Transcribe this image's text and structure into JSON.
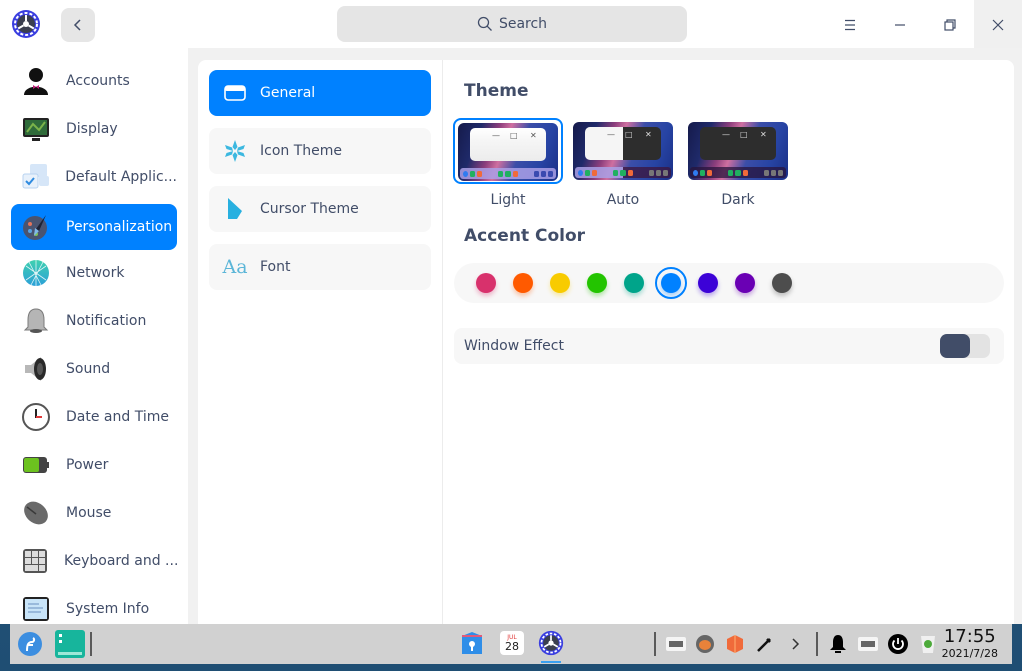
{
  "titlebar": {
    "search_placeholder": "Search",
    "back_icon": "chevron-left-icon",
    "menu_icon": "hamburger-menu-icon",
    "minimize_icon": "minimize-icon",
    "maximize_icon": "restore-icon",
    "close_icon": "close-icon"
  },
  "sidebar": {
    "items": [
      {
        "label": "Accounts",
        "icon": "accounts-icon"
      },
      {
        "label": "Display",
        "icon": "display-icon"
      },
      {
        "label": "Default Applic...",
        "icon": "default-applications-icon"
      },
      {
        "label": "Personalization",
        "icon": "personalization-icon",
        "active": true
      },
      {
        "label": "Network",
        "icon": "network-icon"
      },
      {
        "label": "Notification",
        "icon": "notification-icon"
      },
      {
        "label": "Sound",
        "icon": "sound-icon"
      },
      {
        "label": "Date and Time",
        "icon": "date-time-icon"
      },
      {
        "label": "Power",
        "icon": "power-icon"
      },
      {
        "label": "Mouse",
        "icon": "mouse-icon"
      },
      {
        "label": "Keyboard and ...",
        "icon": "keyboard-icon"
      },
      {
        "label": "System Info",
        "icon": "system-info-icon"
      }
    ]
  },
  "subnav": {
    "items": [
      {
        "label": "General",
        "icon": "general-window-icon",
        "active": true
      },
      {
        "label": "Icon Theme",
        "icon": "icon-theme-icon"
      },
      {
        "label": "Cursor Theme",
        "icon": "cursor-theme-icon"
      },
      {
        "label": "Font",
        "icon": "font-icon",
        "glyph": "Aa"
      }
    ]
  },
  "general": {
    "theme_title": "Theme",
    "themes": [
      {
        "label": "Light",
        "selected": true
      },
      {
        "label": "Auto"
      },
      {
        "label": "Dark"
      }
    ],
    "accent_title": "Accent Color",
    "accent_colors": [
      "#d8316c",
      "#ff5a00",
      "#f8cb00",
      "#23c400",
      "#00a48a",
      "#0081ff",
      "#3c02d7",
      "#6a00b4",
      "#4d4d4d"
    ],
    "accent_selected": "#0081ff",
    "window_effect_label": "Window Effect",
    "window_effect_enabled": false
  },
  "taskbar": {
    "left_icons": [
      "fedora-launcher-icon",
      "multitask-view-icon"
    ],
    "center_icons": [
      "file-manager-icon",
      "calendar-icon",
      "control-center-icon"
    ],
    "calendar_month": "JUL",
    "calendar_day": "28",
    "tray_icons": [
      "keyboard-layout-icon",
      "hamster-icon",
      "package-icon",
      "pen-icon",
      "expand-tray-icon",
      "notification-bell-icon",
      "onscreen-keyboard-icon",
      "shutdown-icon",
      "trash-icon"
    ],
    "time": "17:55",
    "date": "2021/7/28"
  },
  "colors": {
    "accent": "#0081ff",
    "text": "#414d68"
  }
}
